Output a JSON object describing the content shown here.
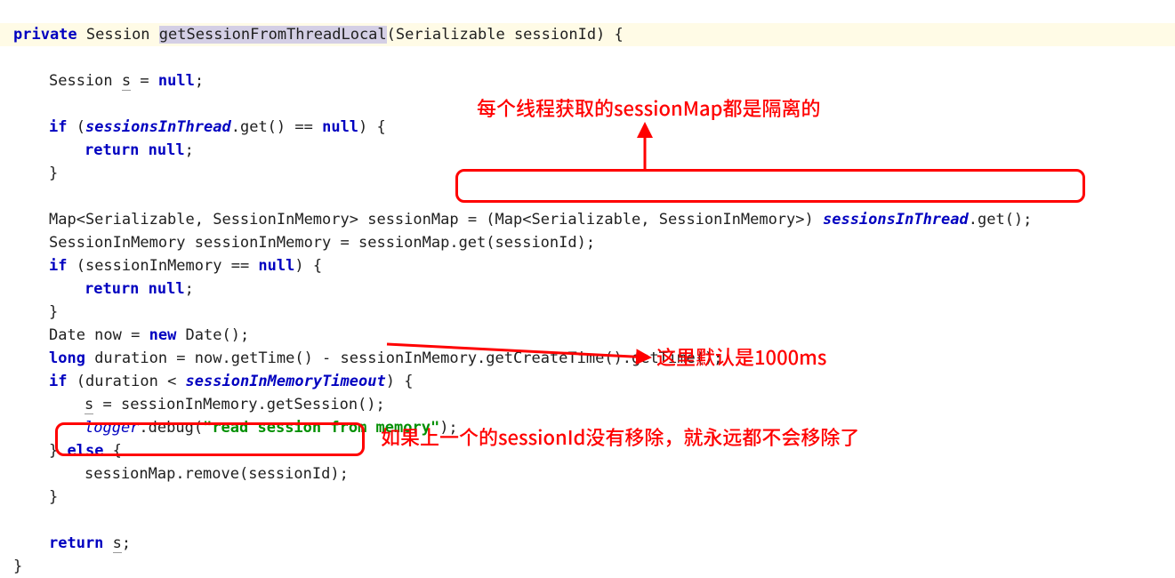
{
  "code": {
    "l1a": "private",
    "l1b": " Session ",
    "l1c": "getSessionFromThreadLocal",
    "l1d": "(Serializable sessionId) {",
    "l2a": "Session ",
    "l2b": "s",
    "l2c": " = ",
    "l2d": "null",
    "l2e": ";",
    "l4a": "if",
    "l4b": " (",
    "l4c": "sessionsInThread",
    "l4d": ".get() == ",
    "l4e": "null",
    "l4f": ") {",
    "l5a": "return null",
    "l5b": ";",
    "l6": "}",
    "l8a": "Map<Serializable, SessionInMemory> sessionMap ",
    "l8b": "= (Map<Serializable, SessionInMemory>) ",
    "l8c": "sessionsInThread",
    "l8d": ".get();",
    "l9": "SessionInMemory sessionInMemory = sessionMap.get(sessionId);",
    "l10a": "if",
    "l10b": " (sessionInMemory == ",
    "l10c": "null",
    "l10d": ") {",
    "l11a": "return null",
    "l11b": ";",
    "l12": "}",
    "l13a": "Date now = ",
    "l13b": "new",
    "l13c": " Date();",
    "l14a": "long",
    "l14b": " duration = now.getTime() - sessionInMemory.getCreateTime().getTime();",
    "l15a": "if",
    "l15b": " (duration < ",
    "l15c": "sessionInMemoryTimeout",
    "l15d": ") {",
    "l16a": "s",
    "l16b": " = sessionInMemory.getSession();",
    "l17a": "logger",
    "l17b": ".debug(",
    "l17c": "\"read session from memory\"",
    "l17d": ");",
    "l18a": "} ",
    "l18b": "else",
    "l18c": " {",
    "l19": "sessionMap.remove(sessionId);",
    "l20": "}",
    "l22a": "return",
    "l22b": " ",
    "l22c": "s",
    "l22d": ";",
    "l23": "}"
  },
  "annotations": {
    "note1": "每个线程获取的sessionMap都是隔离的",
    "note2": "这里默认是1000ms",
    "note3": "如果上一个的sessionId没有移除，就永远都不会移除了"
  }
}
